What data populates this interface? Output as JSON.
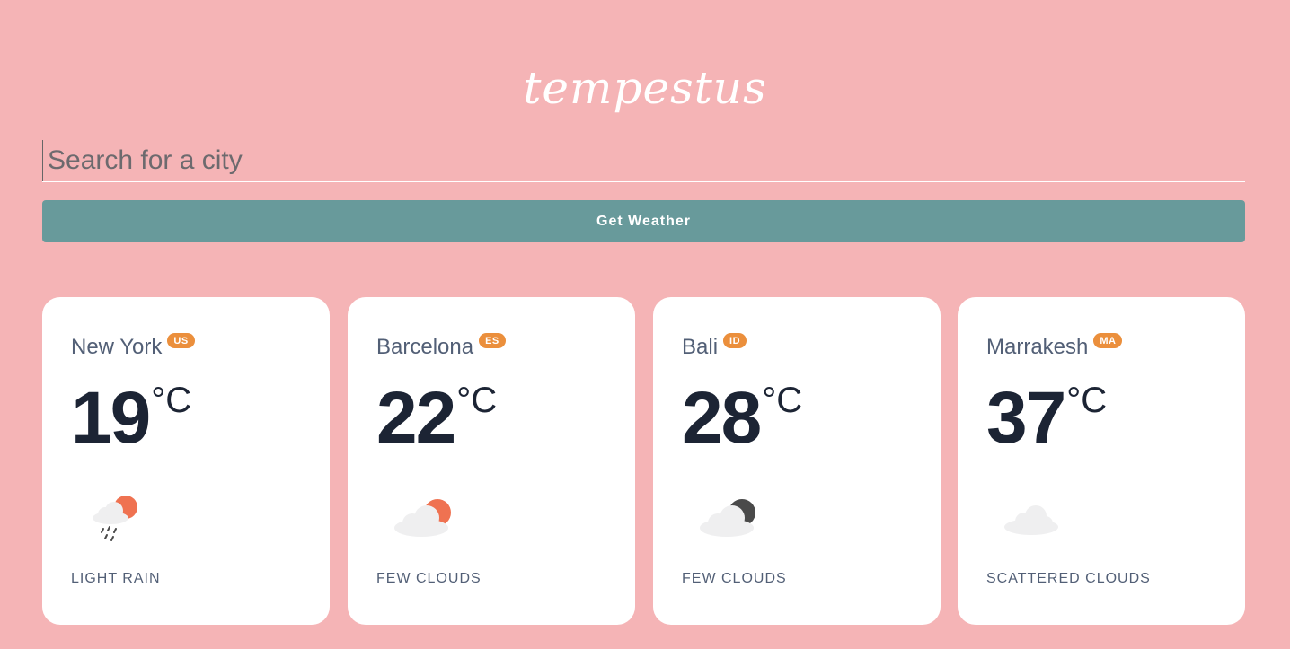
{
  "app": {
    "logo": "tempestus"
  },
  "search": {
    "placeholder": "Search for a city",
    "value": ""
  },
  "actions": {
    "get_weather_label": "Get Weather"
  },
  "colors": {
    "background": "#f5b4b6",
    "button": "#689a9b",
    "badge": "#eb8f3c",
    "sun": "#ef7251",
    "moon": "#4a4a4a",
    "cloud": "#efeff0"
  },
  "cards": [
    {
      "city": "New York",
      "country": "US",
      "temp": "19",
      "unit": "°C",
      "icon": "light-rain-day-icon",
      "description": "LIGHT RAIN"
    },
    {
      "city": "Barcelona",
      "country": "ES",
      "temp": "22",
      "unit": "°C",
      "icon": "few-clouds-day-icon",
      "description": "FEW CLOUDS"
    },
    {
      "city": "Bali",
      "country": "ID",
      "temp": "28",
      "unit": "°C",
      "icon": "few-clouds-night-icon",
      "description": "FEW CLOUDS"
    },
    {
      "city": "Marrakesh",
      "country": "MA",
      "temp": "37",
      "unit": "°C",
      "icon": "scattered-clouds-icon",
      "description": "SCATTERED CLOUDS"
    }
  ]
}
